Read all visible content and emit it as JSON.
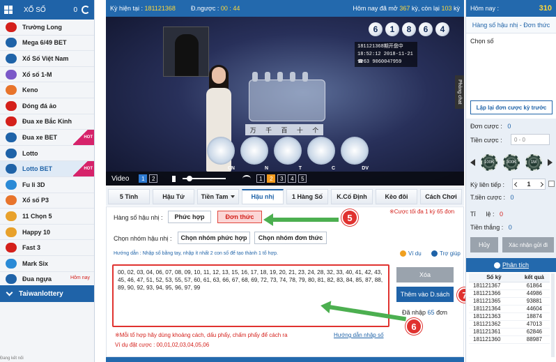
{
  "sidebar": {
    "title": "XỔ SỐ",
    "count": "0",
    "items": [
      {
        "label": "Trường Long",
        "icon": "dragon-icon",
        "color": "#d4201b",
        "hot": false
      },
      {
        "label": "Mega 6/49 BET",
        "icon": "bet-icon",
        "color": "#1f63a8",
        "hot": false
      },
      {
        "label": "Xổ Số Việt Nam",
        "icon": "vietnam-lottery-icon",
        "color": "#1f63a8",
        "hot": false
      },
      {
        "label": "Xổ số 1-M",
        "icon": "1m-icon",
        "color": "#7b58c8",
        "hot": false
      },
      {
        "label": "Keno",
        "icon": "keno-icon",
        "color": "#e8742b",
        "hot": false
      },
      {
        "label": "Đóng đá ảo",
        "icon": "soccer-icon",
        "color": "#d4201b",
        "hot": false
      },
      {
        "label": "Đua xe Bắc Kinh",
        "icon": "racing-icon",
        "color": "#d4201b",
        "hot": false
      },
      {
        "label": "Đua xe BET",
        "icon": "bet-icon",
        "color": "#1f63a8",
        "hot": true
      },
      {
        "label": "Lotto",
        "icon": "bet-icon",
        "color": "#1f63a8",
        "hot": false
      },
      {
        "label": "Lotto BET",
        "icon": "bet-icon",
        "color": "#1f63a8",
        "hot": true,
        "active": true
      },
      {
        "label": "Fu li 3D",
        "icon": "3d-icon",
        "color": "#2a8ad6",
        "hot": false
      },
      {
        "label": "Xổ số P3",
        "icon": "p3-icon",
        "color": "#e8742b",
        "hot": false
      },
      {
        "label": "11 Chọn 5",
        "icon": "11x5-icon",
        "color": "#e8a12b",
        "hot": false
      },
      {
        "label": "Happy 10",
        "icon": "happy10-icon",
        "color": "#e8a12b",
        "hot": false
      },
      {
        "label": "Fast 3",
        "icon": "dice-icon",
        "color": "#d4201b",
        "hot": false
      },
      {
        "label": "Mark Six",
        "icon": "marksix-icon",
        "color": "#2a8ad6",
        "hot": false
      },
      {
        "label": "Đua ngựa",
        "icon": "horse-icon",
        "color": "#1f63a8",
        "hot": false,
        "note": "Hôm nay"
      }
    ],
    "hot_label": "HOT",
    "footer": "Taiwanlottery"
  },
  "topbar": {
    "ky_label": "Kỳ hiện tại :",
    "ky_value": "181121368",
    "dn_label": "Đ.ngược :",
    "dn_value": "00 : 44",
    "open_prefix": "Hôm nay đã mở",
    "open_value": "367",
    "open_mid": "kỳ, còn lại",
    "remain_value": "103",
    "remain_suffix": "kỳ"
  },
  "video": {
    "balls": [
      "6",
      "1",
      "8",
      "6",
      "4"
    ],
    "info_lines": [
      "181121368期开盘中",
      "18:52:12 2018-11-21",
      "☎63 9060047959"
    ],
    "chars": [
      "万",
      "千",
      "百",
      "十",
      "个"
    ],
    "cage_labels": [
      "CN",
      "N",
      "T",
      "C",
      "DV"
    ],
    "side_chat": "Phòng chat",
    "bar_label": "Video",
    "views": [
      "1",
      "2"
    ],
    "qualities": [
      "1",
      "2",
      "3",
      "4",
      "5"
    ]
  },
  "tabs": [
    {
      "label": "5 Tinh"
    },
    {
      "label": "Hậu Tứ"
    },
    {
      "label": "Tiền Tam",
      "dropdown": true
    },
    {
      "label": "Hậu nhị",
      "active": true
    },
    {
      "label": "1 Hàng Số"
    },
    {
      "label": "K.Cố Định"
    },
    {
      "label": "Kèo đôi"
    },
    {
      "label": "Cách Chơi"
    }
  ],
  "form": {
    "hang_so_label": "Hàng số hậu nhị :",
    "phuc_hop": "Phức hợp",
    "don_thuc": "Đơn thức",
    "note_max": "※Cược tối đa 1 kỳ 65 đơn",
    "chon_nhom_label": "Chọn nhóm hậu nhị :",
    "chon_nhom_phuc_hop": "Chọn nhóm phức hợp",
    "chon_nhom_don_thuc": "Chọn nhóm đơn thức",
    "guide": "Hướng dẫn : Nhập số bằng tay, nhập ít nhất 2 con số để tạo thành 1 tổ hợp.",
    "vi_du": "Ví dụ",
    "tro_giup": "Trợ giúp",
    "numbers": "00, 02, 03, 04, 06, 07, 08, 09, 10, 11, 12, 13, 15, 16, 17, 18, 19, 20, 21, 23, 24, 28, 32, 33, 40, 41, 42, 43, 45, 46, 47, 51, 52, 53, 55, 57, 60, 61, 63, 66, 67, 68, 69, 72, 73, 74, 78, 79, 80, 81, 82, 83, 84, 85, 87, 88, 89, 90, 92, 93, 94, 95, 96, 97, 99",
    "xoa": "Xóa",
    "them_vao": "Thêm vào D.sách",
    "entered_prefix": "Đã nhập",
    "entered_count": "65",
    "entered_suffix": "đơn",
    "hint1": "※Mỗi tổ hợp hãy dùng khoảng cách, dấu phẩy, chấm phẩy để cách ra",
    "hint2": "Ví dụ đặt cược : 00,01,02,03,04,05,06",
    "hd_link": "Hướng dẫn nhập số"
  },
  "annotations": {
    "five": "5",
    "six": "6",
    "seven": "7"
  },
  "right_panel": {
    "title": "Hôm nay :",
    "value": "310",
    "subtitle": "Hàng số hậu nhị - Đơn thức",
    "chon_so": "Chọn số",
    "repeat": "Lập lại đơn cược kỳ trước",
    "don_cuoc_label": "Đơn cược :",
    "don_cuoc_value": "0",
    "tien_cuoc_label": "Tiền cược :",
    "tien_cuoc_placeholder": "0 - 0",
    "chips": [
      "100K",
      "300K",
      "1M"
    ],
    "ky_lien_tiep_label": "Kỳ liên tiếp :",
    "ky_lien_tiep_value": "1",
    "t_tien_cuoc_label": "T.tiền cược :",
    "t_tien_cuoc_value": "0",
    "ti_le_label": "Tỉ      lệ :",
    "ti_le_value": "0",
    "tien_thang_label": "Tiền thắng :",
    "tien_thang_value": "0",
    "huy": "Hủy",
    "xac_nhan": "Xác nhận gửi đi",
    "phan_tich": "Phân tích",
    "table_headers": [
      "Số kỳ",
      "kết quả"
    ],
    "results": [
      [
        "181121367",
        "61864"
      ],
      [
        "181121366",
        "44986"
      ],
      [
        "181121365",
        "93881"
      ],
      [
        "181121364",
        "44604"
      ],
      [
        "181121363",
        "18874"
      ],
      [
        "181121362",
        "47013"
      ],
      [
        "181121361",
        "62846"
      ],
      [
        "181121360",
        "88987"
      ]
    ]
  },
  "colors": {
    "primary": "#1f63a8",
    "header": "#2369ad",
    "accent_red": "#d4201b",
    "highlight": "#ffd83a",
    "arrow": "#4caf50"
  },
  "status_left": "Đang kết nối"
}
